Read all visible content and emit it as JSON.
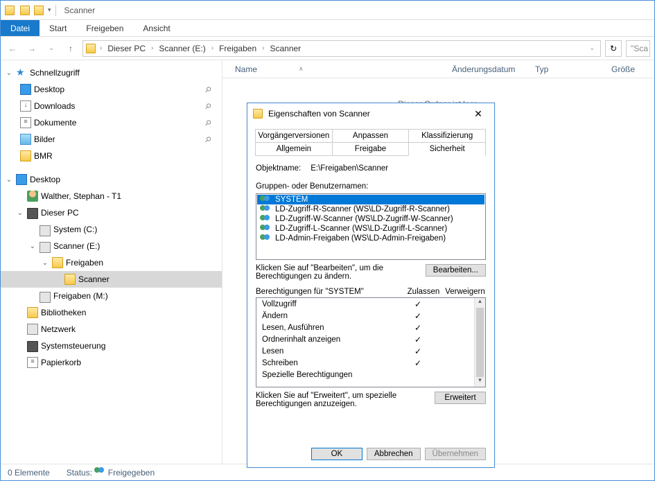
{
  "titlebar": {
    "title": "Scanner"
  },
  "ribbon": {
    "tabs": [
      "Datei",
      "Start",
      "Freigeben",
      "Ansicht"
    ],
    "active": 0
  },
  "breadcrumb": [
    "Dieser PC",
    "Scanner (E:)",
    "Freigaben",
    "Scanner"
  ],
  "search_placeholder": "\"Sca",
  "columns": {
    "name": "Name",
    "date": "Änderungsdatum",
    "type": "Typ",
    "size": "Größe"
  },
  "empty_text": "Dieser Ordner ist leer.",
  "status": {
    "count": "0 Elemente",
    "share_label": "Status:",
    "share_value": "Freigegeben"
  },
  "tree": {
    "quick": {
      "label": "Schnellzugriff",
      "items": [
        {
          "label": "Desktop",
          "pin": true,
          "icon": "ico-desktop"
        },
        {
          "label": "Downloads",
          "pin": true,
          "icon": "ico-dl"
        },
        {
          "label": "Dokumente",
          "pin": true,
          "icon": "ico-doc"
        },
        {
          "label": "Bilder",
          "pin": true,
          "icon": "ico-pic"
        },
        {
          "label": "BMR",
          "pin": false,
          "icon": "ico-folder"
        }
      ]
    },
    "desktop": {
      "label": "Desktop",
      "items": [
        {
          "label": "Walther, Stephan - T1",
          "icon": "ico-user"
        },
        {
          "label": "Dieser PC",
          "icon": "ico-pc",
          "expanded": true,
          "children": [
            {
              "label": "System (C:)",
              "icon": "ico-drive"
            },
            {
              "label": "Scanner (E:)",
              "icon": "ico-drive",
              "expanded": true,
              "children": [
                {
                  "label": "Freigaben",
                  "icon": "ico-folder",
                  "expanded": true,
                  "children": [
                    {
                      "label": "Scanner",
                      "icon": "ico-folder",
                      "selected": true
                    }
                  ]
                }
              ]
            },
            {
              "label": "Freigaben (M:)",
              "icon": "ico-drive"
            }
          ]
        },
        {
          "label": "Bibliotheken",
          "icon": "ico-folder"
        },
        {
          "label": "Netzwerk",
          "icon": "ico-net"
        },
        {
          "label": "Systemsteuerung",
          "icon": "ico-pc"
        },
        {
          "label": "Papierkorb",
          "icon": "ico-doc"
        }
      ]
    }
  },
  "dialog": {
    "title": "Eigenschaften von Scanner",
    "tabs_row1": [
      "Vorgängerversionen",
      "Anpassen",
      "Klassifizierung"
    ],
    "tabs_row2": [
      "Allgemein",
      "Freigabe",
      "Sicherheit"
    ],
    "active_tab": "Sicherheit",
    "objectname_label": "Objektname:",
    "objectname_value": "E:\\Freigaben\\Scanner",
    "groups_label": "Gruppen- oder Benutzernamen:",
    "group_items": [
      "SYSTEM",
      "LD-Zugriff-R-Scanner (WS\\LD-Zugriff-R-Scanner)",
      "LD-Zugriff-W-Scanner (WS\\LD-Zugriff-W-Scanner)",
      "LD-Zugriff-L-Scanner (WS\\LD-Zugriff-L-Scanner)",
      "LD-Admin-Freigaben (WS\\LD-Admin-Freigaben)"
    ],
    "edit_hint": "Klicken Sie auf \"Bearbeiten\", um die Berechtigungen zu ändern.",
    "edit_btn": "Bearbeiten...",
    "perm_title": "Berechtigungen für \"SYSTEM\"",
    "perm_allow": "Zulassen",
    "perm_deny": "Verweigern",
    "perms": [
      {
        "name": "Vollzugriff",
        "allow": true,
        "deny": false
      },
      {
        "name": "Ändern",
        "allow": true,
        "deny": false
      },
      {
        "name": "Lesen, Ausführen",
        "allow": true,
        "deny": false
      },
      {
        "name": "Ordnerinhalt anzeigen",
        "allow": true,
        "deny": false
      },
      {
        "name": "Lesen",
        "allow": true,
        "deny": false
      },
      {
        "name": "Schreiben",
        "allow": true,
        "deny": false
      },
      {
        "name": "Spezielle Berechtigungen",
        "allow": false,
        "deny": false
      }
    ],
    "adv_hint": "Klicken Sie auf \"Erweitert\", um spezielle Berechtigungen anzuzeigen.",
    "adv_btn": "Erweitert",
    "ok": "OK",
    "cancel": "Abbrechen",
    "apply": "Übernehmen"
  }
}
